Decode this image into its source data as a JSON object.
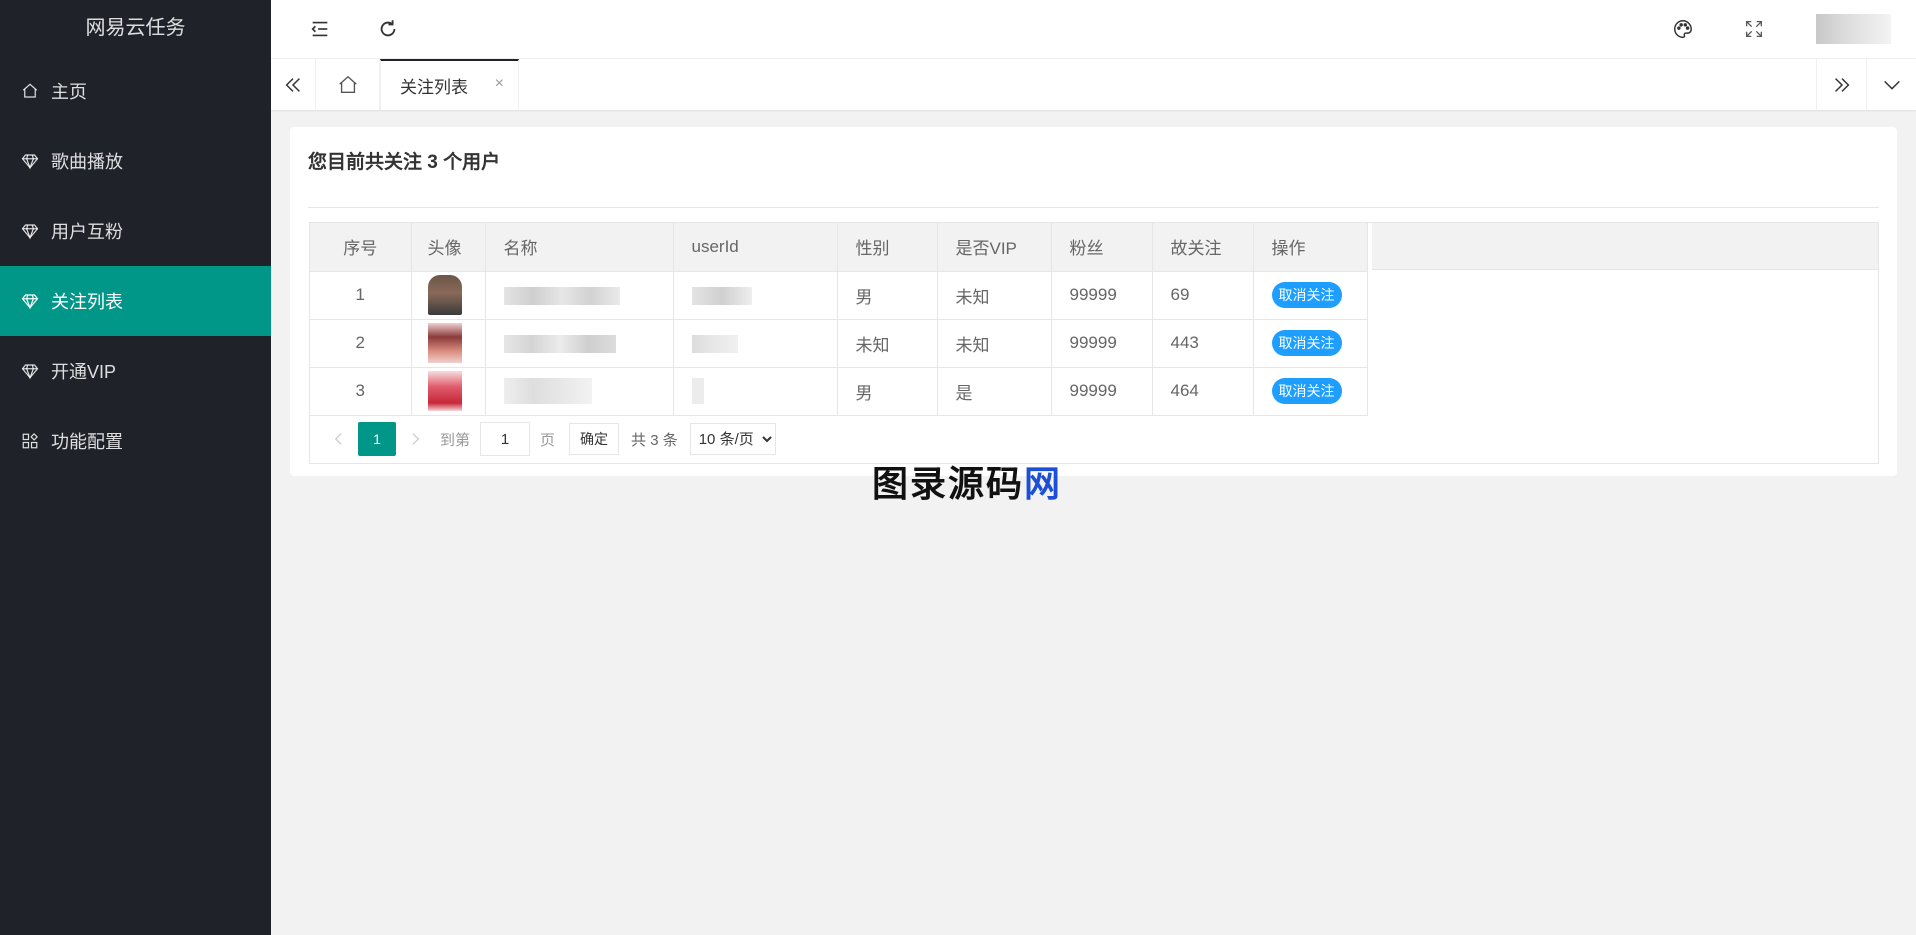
{
  "sidebar": {
    "app_title": "网易云任务",
    "items": [
      {
        "label": "主页",
        "icon": "home-icon"
      },
      {
        "label": "歌曲播放",
        "icon": "diamond-icon"
      },
      {
        "label": "用户互粉",
        "icon": "diamond-icon"
      },
      {
        "label": "关注列表",
        "icon": "diamond-icon",
        "active": true
      },
      {
        "label": "开通VIP",
        "icon": "diamond-icon"
      },
      {
        "label": "功能配置",
        "icon": "apps-icon"
      }
    ]
  },
  "header": {
    "icons": [
      "menu-indent-icon",
      "refresh-icon",
      "palette-icon",
      "fullscreen-icon"
    ]
  },
  "tabs": {
    "active_label": "关注列表",
    "close_glyph": "×"
  },
  "page": {
    "title": "您目前共关注 3 个用户"
  },
  "table": {
    "headers": [
      "序号",
      "头像",
      "名称",
      "userId",
      "性别",
      "是否VIP",
      "粉丝",
      "故关注",
      "操作"
    ],
    "rows": [
      {
        "index": "1",
        "gender": "男",
        "vip": "未知",
        "fans": "99999",
        "follows": "69",
        "action": "取消关注"
      },
      {
        "index": "2",
        "gender": "未知",
        "vip": "未知",
        "fans": "99999",
        "follows": "443",
        "action": "取消关注"
      },
      {
        "index": "3",
        "gender": "男",
        "vip": "是",
        "fans": "99999",
        "follows": "464",
        "action": "取消关注"
      }
    ]
  },
  "pagination": {
    "current_page": "1",
    "goto_label": "到第",
    "goto_value": "1",
    "page_label": "页",
    "confirm_label": "确定",
    "total_label": "共 3 条",
    "page_size_option": "10 条/页"
  },
  "watermark": {
    "text_a": "图录",
    "text_b": "源码",
    "text_c": "网"
  },
  "colors": {
    "sidebar_bg": "#20222a",
    "active_green": "#009688",
    "button_blue": "#1e9fff",
    "page_bg": "#f2f2f2"
  }
}
